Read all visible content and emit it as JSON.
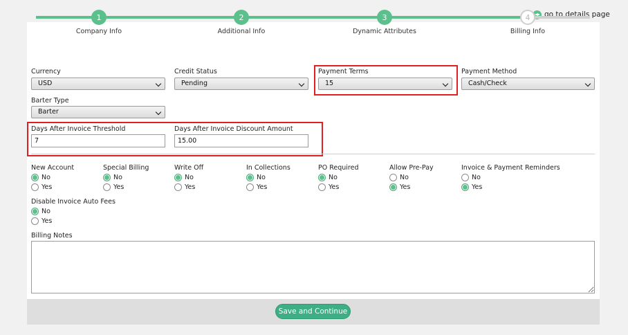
{
  "header": {
    "goto_details": "go to details page"
  },
  "stepper": {
    "steps": [
      {
        "number": "1",
        "label": "Company Info"
      },
      {
        "number": "2",
        "label": "Additional Info"
      },
      {
        "number": "3",
        "label": "Dynamic Attributes"
      },
      {
        "number": "4",
        "label": "Billing Info"
      }
    ]
  },
  "fields": {
    "currency": {
      "label": "Currency",
      "value": "USD"
    },
    "credit_status": {
      "label": "Credit Status",
      "value": "Pending"
    },
    "payment_terms": {
      "label": "Payment Terms",
      "value": "15"
    },
    "payment_method": {
      "label": "Payment Method",
      "value": "Cash/Check"
    },
    "barter_type": {
      "label": "Barter Type",
      "value": "Barter"
    },
    "days_threshold": {
      "label": "Days After Invoice Threshold",
      "value": "7"
    },
    "days_discount": {
      "label": "Days After Invoice Discount Amount",
      "value": "15.00"
    }
  },
  "radios": {
    "new_account": {
      "label": "New Account",
      "options": [
        "No",
        "Yes"
      ],
      "selected": "No"
    },
    "special_billing": {
      "label": "Special Billing",
      "options": [
        "No",
        "Yes"
      ],
      "selected": "No"
    },
    "write_off": {
      "label": "Write Off",
      "options": [
        "No",
        "Yes"
      ],
      "selected": "No"
    },
    "in_collections": {
      "label": "In Collections",
      "options": [
        "No",
        "Yes"
      ],
      "selected": "No"
    },
    "po_required": {
      "label": "PO Required",
      "options": [
        "No",
        "Yes"
      ],
      "selected": "No"
    },
    "allow_prepay": {
      "label": "Allow Pre-Pay",
      "options": [
        "No",
        "Yes"
      ],
      "selected": "Yes"
    },
    "reminders": {
      "label": "Invoice & Payment Reminders",
      "options": [
        "No",
        "Yes"
      ],
      "selected": "Yes"
    },
    "disable_auto_fees": {
      "label": "Disable Invoice Auto Fees",
      "options": [
        "No",
        "Yes"
      ],
      "selected": "No"
    }
  },
  "notes": {
    "label": "Billing Notes",
    "value": ""
  },
  "footer": {
    "save_label": "Save and Continue"
  },
  "colors": {
    "accent": "#5cc08d",
    "button": "#3eae84",
    "highlight": "#e02020",
    "inactive_track": "#d0d0d0"
  }
}
